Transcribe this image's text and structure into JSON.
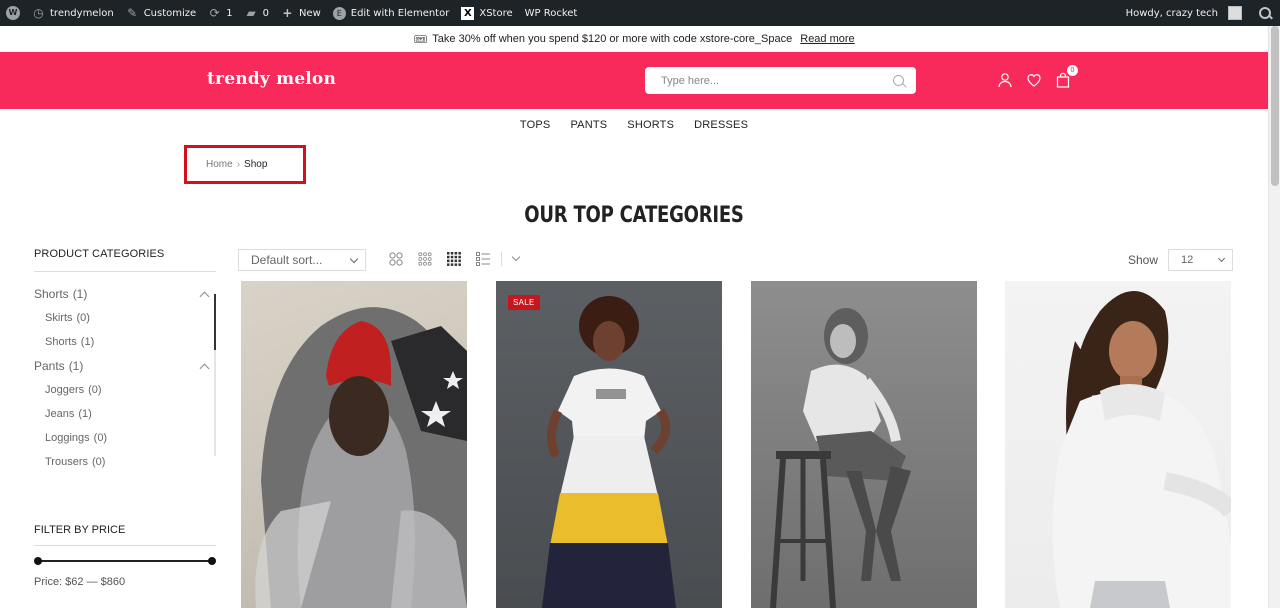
{
  "admin_bar": {
    "site": "trendymelon",
    "customize": "Customize",
    "updates": "1",
    "comments": "0",
    "new": "New",
    "edit_elementor": "Edit with Elementor",
    "xstore": "XStore",
    "wp_rocket": "WP Rocket",
    "howdy": "Howdy, crazy tech"
  },
  "promo": {
    "text": "Take 30% off when you spend $120 or more with code xstore-core_Space",
    "link": "Read more"
  },
  "header": {
    "logo": "trendy melon",
    "search_placeholder": "Type here...",
    "cart_count": "0",
    "bg_color": "#f72a5b"
  },
  "nav": [
    "TOPS",
    "PANTS",
    "SHORTS",
    "DRESSES"
  ],
  "breadcrumb": {
    "home": "Home",
    "separator": "›",
    "current": "Shop"
  },
  "title": "OUR TOP CATEGORIES",
  "sidebar": {
    "categories_title": "PRODUCT CATEGORIES",
    "categories": [
      {
        "label": "Shorts",
        "count": "(1)"
      },
      {
        "label": "Skirts",
        "count": "(0)"
      },
      {
        "label": "Shorts",
        "count": "(1)"
      },
      {
        "label": "Pants",
        "count": "(1)"
      },
      {
        "label": "Joggers",
        "count": "(0)"
      },
      {
        "label": "Jeans",
        "count": "(1)"
      },
      {
        "label": "Loggings",
        "count": "(0)"
      },
      {
        "label": "Trousers",
        "count": "(0)"
      }
    ],
    "price_title": "FILTER BY PRICE",
    "price_text": "Price: $62 — $860"
  },
  "toolbar": {
    "sort_label": "Default sort...",
    "show_label": "Show",
    "show_value": "12"
  },
  "products": [
    {
      "badge": ""
    },
    {
      "badge": "SALE"
    },
    {
      "badge": ""
    },
    {
      "badge": ""
    }
  ]
}
